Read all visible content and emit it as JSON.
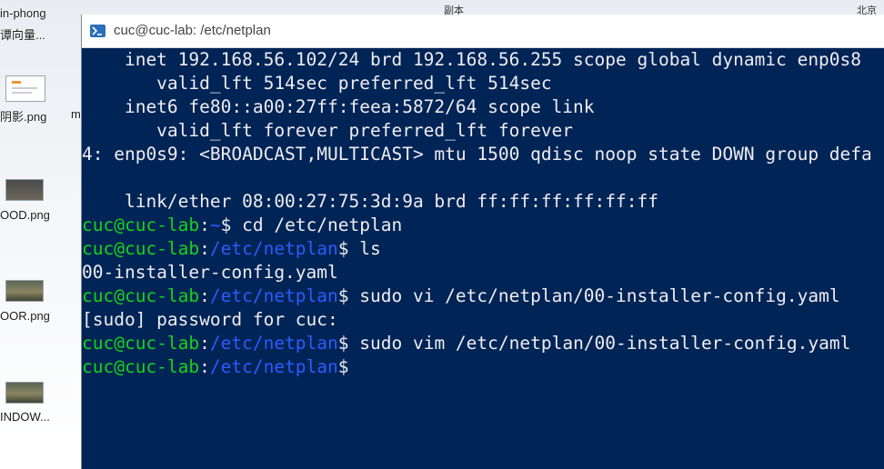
{
  "desktop": {
    "items": [
      {
        "label": "in-phong",
        "label2": "谭向量..."
      },
      {
        "label": "阴影.png",
        "label_extra": "m"
      },
      {
        "label": "OOD.png"
      },
      {
        "label": "OOR.png"
      },
      {
        "label": "INDOW..."
      }
    ]
  },
  "top_strip": {
    "left_text": "副本",
    "right_text": "北京"
  },
  "window": {
    "title": "cuc@cuc-lab: /etc/netplan",
    "icon": "powershell-icon"
  },
  "terminal": {
    "colors": {
      "background": "#012456",
      "prompt_user": "#13d41c",
      "prompt_path": "#2a5cff",
      "text": "#eeedf0"
    },
    "lines": [
      {
        "text": "    inet 192.168.56.102/24 brd 192.168.56.255 scope global dynamic enp0s8"
      },
      {
        "text": "       valid_lft 514sec preferred_lft 514sec"
      },
      {
        "text": "    inet6 fe80::a00:27ff:feea:5872/64 scope link"
      },
      {
        "text": "       valid_lft forever preferred_lft forever"
      },
      {
        "text": "4: enp0s9: <BROADCAST,MULTICAST> mtu 1500 qdisc noop state DOWN group defa"
      },
      {
        "text": ""
      },
      {
        "text": "    link/ether 08:00:27:75:3d:9a brd ff:ff:ff:ff:ff:ff"
      }
    ],
    "commands": [
      {
        "user": "cuc@cuc-lab",
        "sep": ":",
        "path": "~",
        "dollar": "$ ",
        "cmd": "cd /etc/netplan"
      },
      {
        "user": "cuc@cuc-lab",
        "sep": ":",
        "path": "/etc/netplan",
        "dollar": "$ ",
        "cmd": "ls"
      },
      {
        "output": "00-installer-config.yaml"
      },
      {
        "user": "cuc@cuc-lab",
        "sep": ":",
        "path": "/etc/netplan",
        "dollar": "$ ",
        "cmd": "sudo vi /etc/netplan/00-installer-config.yaml"
      },
      {
        "output": "[sudo] password for cuc:"
      },
      {
        "user": "cuc@cuc-lab",
        "sep": ":",
        "path": "/etc/netplan",
        "dollar": "$ ",
        "cmd": "sudo vim /etc/netplan/00-installer-config.yaml"
      },
      {
        "user": "cuc@cuc-lab",
        "sep": ":",
        "path": "/etc/netplan",
        "dollar": "$",
        "cmd": ""
      }
    ]
  }
}
